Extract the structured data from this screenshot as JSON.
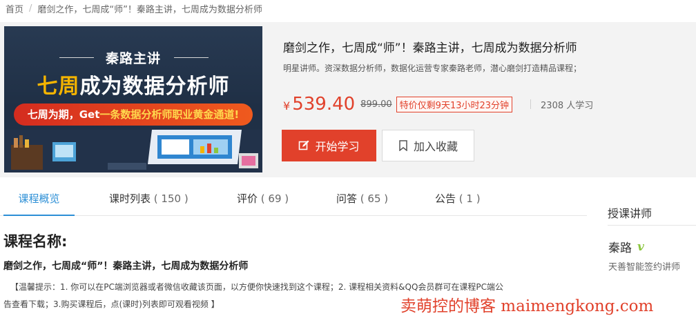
{
  "breadcrumb": {
    "home": "首页",
    "separator": "/",
    "current": "磨剑之作，七周成“师”！秦路主讲，七周成为数据分析师"
  },
  "banner": {
    "lead": "秦路主讲",
    "title_highlight": "七周",
    "title_rest": "成为数据分析师",
    "tagline_a": "七周为期，Get",
    "tagline_b": "一条数据分析师职业黄金通道!"
  },
  "course": {
    "title": "磨剑之作，七周成“师”！秦路主讲，七周成为数据分析师",
    "description": "明星讲师。资深数据分析师，数据化运营专家秦路老师，潜心磨剑打造精品课程；",
    "currency": "¥",
    "price": "539.40",
    "original_price": "899.00",
    "promo": "特价仅剩9天13小时23分钟",
    "learners": "2308 人学习",
    "start_button": "开始学习",
    "favorite_button": "加入收藏",
    "start_icon": "edit-icon",
    "favorite_icon": "bookmark-icon"
  },
  "tabs": [
    {
      "label": "课程概览",
      "count": ""
    },
    {
      "label": "课时列表",
      "count": "( 150 )"
    },
    {
      "label": "评价",
      "count": "( 69 )"
    },
    {
      "label": "问答",
      "count": "( 65 )"
    },
    {
      "label": "公告",
      "count": "( 1 )"
    }
  ],
  "main": {
    "heading": "课程名称:",
    "course_name": "磨剑之作，七周成“师”！秦路主讲，七周成为数据分析师",
    "tip_line1": "【温馨提示：1. 你可以在PC端浏览器或者微信收藏该页面，以方便你快速找到这个课程；2. 课程相关资料&QQ会员群可在课程PC端公",
    "tip_line2": "告查看下载；3.购买课程后，点(课时)列表即可观看视频 】"
  },
  "sidebar": {
    "heading": "授课讲师",
    "teacher_name": "秦路",
    "badge": "v",
    "teacher_role": "天善智能签约讲师"
  },
  "watermark": "卖萌控的博客 maimengkong.com",
  "colors": {
    "accent_red": "#e1412b",
    "accent_blue": "#2c8fd6",
    "badge_green": "#8cc63f"
  }
}
